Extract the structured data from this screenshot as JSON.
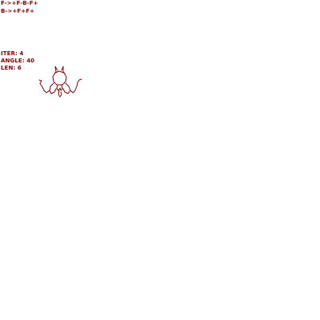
{
  "rules": {
    "f_rule": "F->+F-B-F+",
    "b_rule": "B->+F+F+"
  },
  "params": {
    "iter_text": "ITER: 4",
    "angle_text": "ANGLE: 40",
    "len_text": "LEN: 6"
  },
  "colors": {
    "ink": "#8b0000",
    "background": "#ffffff"
  }
}
